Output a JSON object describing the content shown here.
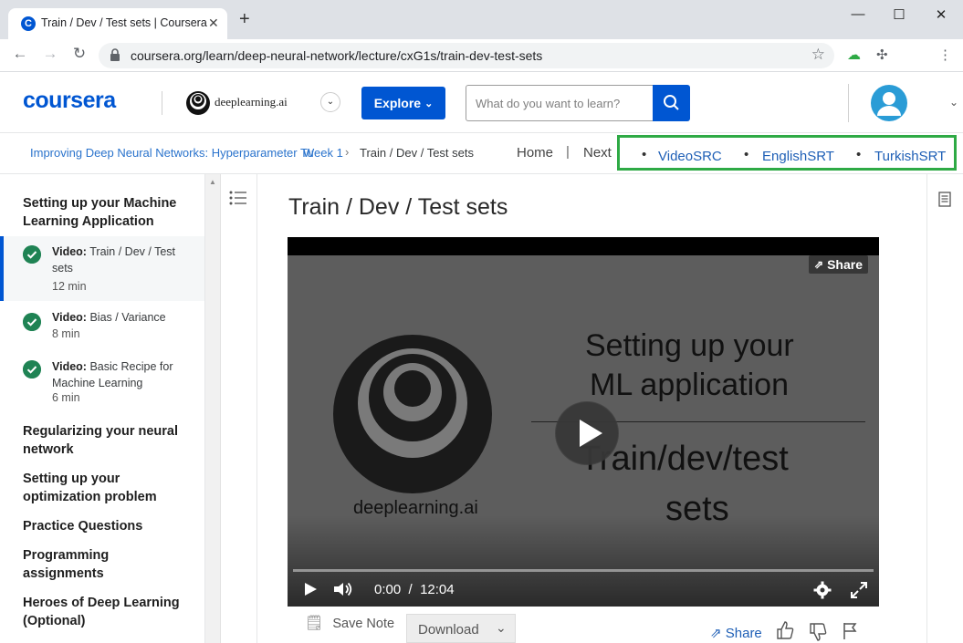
{
  "browser": {
    "tab_title": "Train / Dev / Test sets | Coursera",
    "favicon_letter": "C",
    "url": "coursera.org/learn/deep-neural-network/lecture/cxG1s/train-dev-test-sets"
  },
  "header": {
    "logo": "coursera",
    "partner": "deeplearning.ai",
    "explore_label": "Explore",
    "search_placeholder": "What do you want to learn?"
  },
  "breadcrumb": {
    "course": "Improving Deep Neural Networks: Hyperparameter Tu",
    "week": "Week 1",
    "current": "Train / Dev / Test sets",
    "home": "Home",
    "separator": "|",
    "next": "Next"
  },
  "highlight_links": [
    {
      "label": "VideoSRC"
    },
    {
      "label": "EnglishSRT"
    },
    {
      "label": "TurkishSRT"
    }
  ],
  "sidebar": {
    "section1": "Setting up your Machine Learning Application",
    "items": [
      {
        "prefix": "Video:",
        "title": "Train / Dev / Test sets",
        "duration": "12 min"
      },
      {
        "prefix": "Video:",
        "title": "Bias / Variance",
        "duration": "8 min"
      },
      {
        "prefix": "Video:",
        "title": "Basic Recipe for Machine Learning",
        "duration": "6 min"
      }
    ],
    "sections": [
      "Regularizing your neural network",
      "Setting up your optimization problem",
      "Practice Questions",
      "Programming assignments",
      "Heroes of Deep Learning (Optional)"
    ]
  },
  "main": {
    "title": "Train / Dev / Test sets",
    "video": {
      "share_label": "Share",
      "slide_line1": "Setting up your",
      "slide_line2": "ML application",
      "slide_line3": "Train/dev/test",
      "slide_line4": "sets",
      "slide_brand": "deeplearning.ai",
      "time_current": "0:00",
      "time_sep": "/",
      "time_total": "12:04",
      "progress": 0
    },
    "save_note": "Save Note",
    "download": "Download",
    "share": "Share"
  },
  "colors": {
    "brand": "#0056d2",
    "check": "#1f8354",
    "highlight_box": "#2eaa45"
  }
}
